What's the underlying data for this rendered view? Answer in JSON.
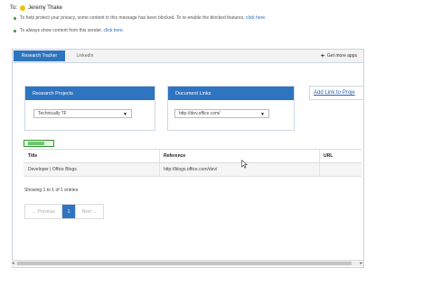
{
  "header": {
    "to_label": "To:",
    "recipient": "Jeremy Thake",
    "notices": [
      {
        "text": "To help protect your privacy, some content in this message has been blocked. To re-enable the blocked features, ",
        "link": "click here."
      },
      {
        "text": "To always show content from this sender, ",
        "link": "click here."
      }
    ]
  },
  "tabs": [
    {
      "label": "Research Tracker",
      "active": true
    },
    {
      "label": "LinkedIn",
      "active": false
    }
  ],
  "get_more_apps": {
    "icon": "plus-icon",
    "label": "Get more apps"
  },
  "research_projects": {
    "title": "Research Projects",
    "selected": "Technically TF"
  },
  "document_links": {
    "title": "Document Links",
    "selected": "http://dev.office.com/"
  },
  "add_link_label": "Add Link to Proje",
  "table": {
    "columns": [
      "Title",
      "Reference",
      "URL"
    ],
    "rows": [
      {
        "title": "Developer | Office Blogs",
        "reference": "http://blogs.office.com/dev/",
        "url": ""
      }
    ]
  },
  "summary": "Showing 1 to 1 of 1 entries",
  "pagination": {
    "prev": "← Previous",
    "page": "1",
    "next": "Next →"
  },
  "colors": {
    "accent": "#2f74c0",
    "success": "#2e9a2e",
    "link": "#2a6ab6"
  }
}
